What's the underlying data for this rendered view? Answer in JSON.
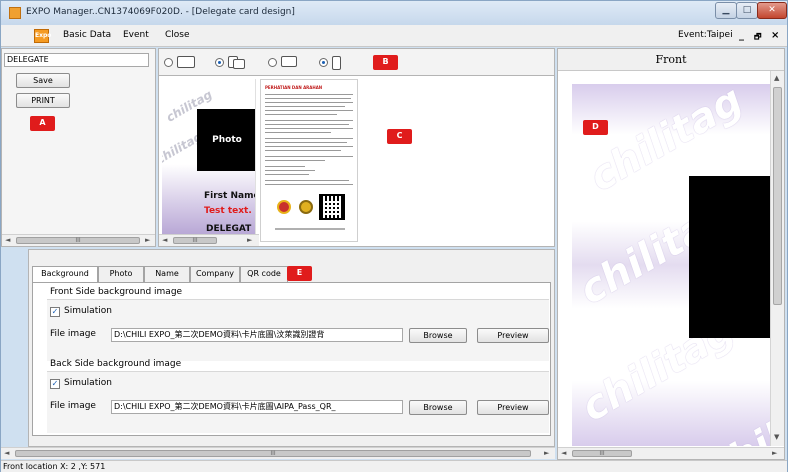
{
  "window": {
    "title": "EXPO Manager..CN1374069F020D. - [Delegate card design]",
    "min_glyph": "▁",
    "max_glyph": "□",
    "close_glyph": "✕"
  },
  "menu": {
    "logo_text": "Expo",
    "items": [
      "Basic Data",
      "Event",
      "Close"
    ],
    "event_label": "Event:Taipei",
    "minimize_glyph": "_",
    "restore_glyph": "🗗",
    "close_glyph": "×"
  },
  "left_panel": {
    "card_type": "DELEGATE",
    "save_label": "Save",
    "print_label": "PRINT"
  },
  "markers": {
    "a": "A",
    "b": "B",
    "c": "C",
    "d": "D",
    "e": "E"
  },
  "card_front": {
    "watermark": "chilitag",
    "photo_label": "Photo",
    "first_name": "First Name",
    "test_text": "Test text.",
    "card_type": "DELEGAT"
  },
  "card_back": {
    "heading": "PERHATIAN DAN ARAHAN"
  },
  "tabs": [
    "Background",
    "Photo",
    "Name",
    "Company",
    "QR code"
  ],
  "background_tab": {
    "front": {
      "title": "Front Side background image",
      "simulation_label": "Simulation",
      "file_label": "File image",
      "path": "D:\\CHILI EXPO_第二次DEMO資料\\卡片底圖\\汶萊識別證背",
      "browse_label": "Browse",
      "preview_label": "Preview"
    },
    "back": {
      "title": "Back Side background image",
      "simulation_label": "Simulation",
      "file_label": "File image",
      "path": "D:\\CHILI EXPO_第二次DEMO資料\\卡片底圖\\AIPA_Pass_QR_",
      "browse_label": "Browse",
      "preview_label": "Preview"
    }
  },
  "right_panel": {
    "header": "Front",
    "watermark": "chilitag"
  },
  "scroll": {
    "left_arrow": "◄",
    "right_arrow": "►",
    "up_arrow": "▲",
    "down_arrow": "▼",
    "grip": "III"
  },
  "status": {
    "text": "Front location X: 2 ,Y: 571"
  },
  "colors": {
    "marker_red": "#e01c1c",
    "accent_purple": "#b9a8d6",
    "title_bar": "#cfe0f0"
  }
}
